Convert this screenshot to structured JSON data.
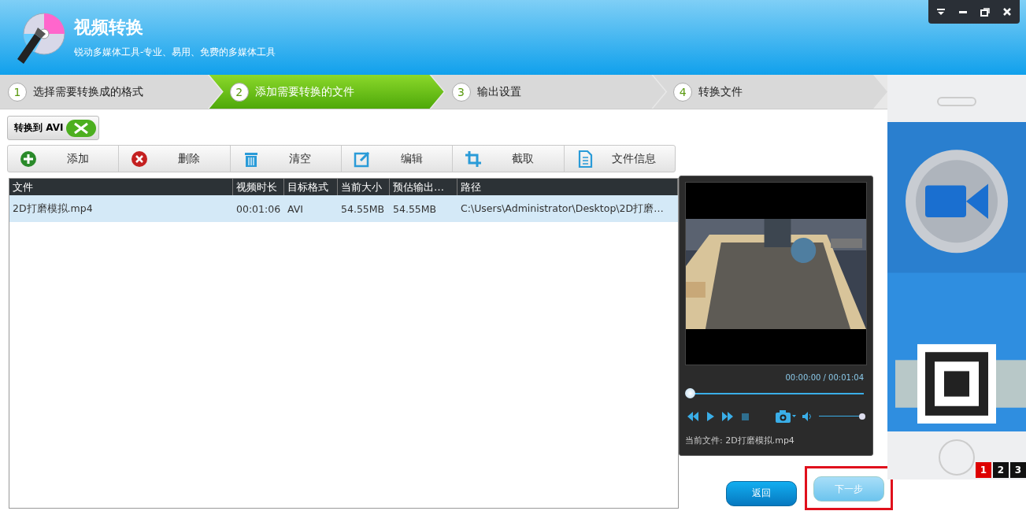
{
  "window": {
    "title": "视频转换",
    "subtitle": "锐动多媒体工具-专业、易用、免费的多媒体工具"
  },
  "steps": [
    {
      "number": "1",
      "label": "选择需要转换成的格式",
      "selected": false
    },
    {
      "number": "2",
      "label": "添加需要转换的文件",
      "selected": true
    },
    {
      "number": "3",
      "label": "输出设置",
      "selected": false
    },
    {
      "number": "4",
      "label": "转换文件",
      "selected": false
    }
  ],
  "format_button": {
    "label": "转换到 AVI"
  },
  "toolbar": [
    {
      "kind": "add",
      "label": "添加"
    },
    {
      "kind": "delete",
      "label": "删除"
    },
    {
      "kind": "clear",
      "label": "清空"
    },
    {
      "kind": "edit",
      "label": "编辑"
    },
    {
      "kind": "crop",
      "label": "截取"
    },
    {
      "kind": "info",
      "label": "文件信息"
    }
  ],
  "table": {
    "columns": [
      "文件",
      "视频时长",
      "目标格式",
      "当前大小",
      "预估输出…",
      "路径"
    ],
    "rows": [
      {
        "selected": true,
        "cells": [
          "2D打磨模拟.mp4",
          "00:01:06",
          "AVI",
          "54.55MB",
          "54.55MB",
          "C:\\Users\\Administrator\\Desktop\\2D打磨…"
        ]
      }
    ]
  },
  "player": {
    "time": "00:00:00 / 00:01:04",
    "seek": {
      "level": 0
    },
    "volume": {
      "level": 1
    },
    "current_file": "当前文件: 2D打磨模拟.mp4"
  },
  "ad": {
    "pages": [
      {
        "label": "1",
        "selected": true
      },
      {
        "label": "2",
        "selected": false
      },
      {
        "label": "3",
        "selected": false
      }
    ]
  },
  "buttons": [
    {
      "label": "返回",
      "disabled": false,
      "highlighted": false
    },
    {
      "label": "下一步",
      "disabled": true,
      "highlighted": true
    }
  ]
}
